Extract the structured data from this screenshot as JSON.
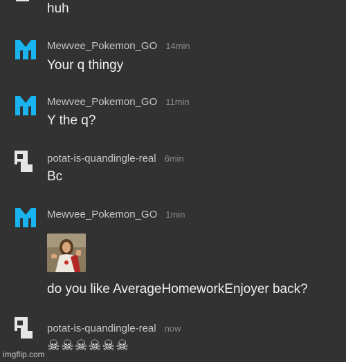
{
  "messages": [
    {
      "avatar": "gray-blocky-avatar",
      "username": "",
      "time": "",
      "text": "huh"
    },
    {
      "avatar": "blue-m-avatar",
      "username": "Mewvee_Pokemon_GO",
      "time": "14min",
      "text": "Your q thingy"
    },
    {
      "avatar": "blue-m-avatar",
      "username": "Mewvee_Pokemon_GO",
      "time": "11min",
      "text": "Y the q?"
    },
    {
      "avatar": "gray-blocky-avatar",
      "username": "potat-is-quandingle-real",
      "time": "6min",
      "text": "Bc"
    },
    {
      "avatar": "blue-m-avatar",
      "username": "Mewvee_Pokemon_GO",
      "time": "1min",
      "text": "do you like AverageHomeworkEnjoyer back?",
      "has_image": true
    },
    {
      "avatar": "gray-blocky-avatar",
      "username": "potat-is-quandingle-real",
      "time": "now",
      "text": "☠☠☠☠☠☠"
    }
  ],
  "watermark": "imgflip.com",
  "colors": {
    "background": "#323232",
    "blue_avatar": "#19b3ef",
    "gray_avatar": "#e6e6e6"
  }
}
